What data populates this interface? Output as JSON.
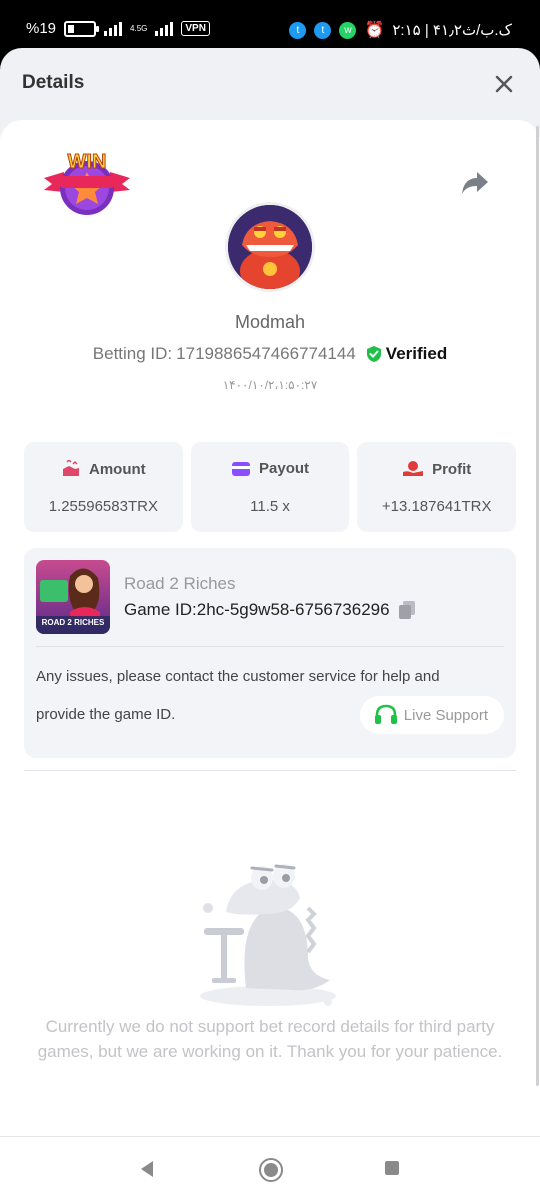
{
  "status_bar": {
    "battery": "%19",
    "network": "4.5G",
    "vpn": "VPN",
    "time_info": "۲:۱۵ | ۴۱٫۲ک.ب/ث"
  },
  "header": {
    "title": "Details"
  },
  "bet": {
    "username": "Modmah",
    "betting_id_label": "Betting ID:",
    "betting_id": "1719886547466774144",
    "verified": "Verified",
    "timestamp": "۱۴۰۰/۱۰/۲،۱:۵۰:۲۷"
  },
  "stats": [
    {
      "label": "Amount",
      "value": "1.25596583TRX"
    },
    {
      "label": "Payout",
      "value": "11.5 x"
    },
    {
      "label": "Profit",
      "value": "+13.187641TRX"
    }
  ],
  "game": {
    "name": "Road 2 Riches",
    "thumb_label": "ROAD 2 RICHES",
    "id_label": "Game ID:",
    "id": "2hc-5g9w58-6756736296"
  },
  "support": {
    "line1": "Any issues, please contact the customer service for help and",
    "line2": "provide the game ID.",
    "button": "Live Support"
  },
  "empty_state": {
    "message": "Currently we do not support bet record details for third party games, but we are working on it. Thank you for your patience."
  },
  "colors": {
    "verified": "#1fbf4a",
    "amount_icon": "#e0456a",
    "payout_icon": "#8a4dff",
    "profit_icon": "#e03a3a",
    "support_icon": "#21c24a"
  },
  "icons": [
    "close-icon",
    "share-icon",
    "win-badge",
    "amount-icon",
    "payout-icon",
    "profit-icon",
    "copy-icon",
    "headset-icon",
    "shield-check-icon"
  ]
}
